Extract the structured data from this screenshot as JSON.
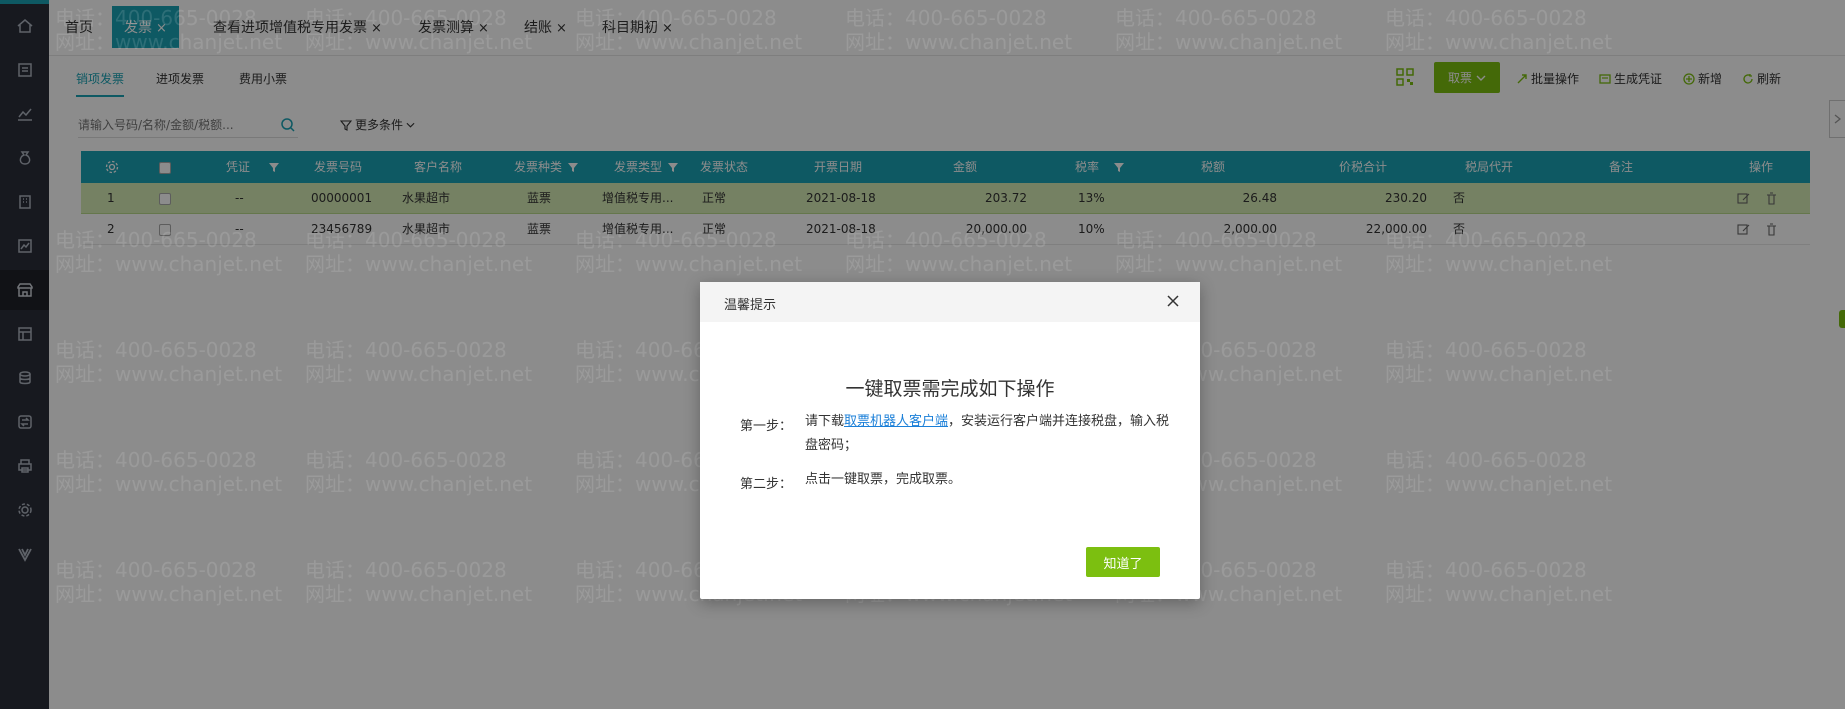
{
  "tabs": [
    {
      "label": "首页",
      "closable": false
    },
    {
      "label": "发票",
      "closable": true,
      "active": true
    },
    {
      "label": "查看进项增值税专用发票",
      "closable": true
    },
    {
      "label": "发票测算",
      "closable": true
    },
    {
      "label": "结账",
      "closable": true
    },
    {
      "label": "科目期初",
      "closable": true
    }
  ],
  "close_glyph": "×",
  "subtabs": [
    "销项发票",
    "进项发票",
    "费用小票"
  ],
  "toolbar": {
    "fetch_label": "取票",
    "batch_label": "批量操作",
    "voucher_label": "生成凭证",
    "add_label": "新增",
    "refresh_label": "刷新"
  },
  "search": {
    "placeholder": "请输入号码/名称/金额/税额..."
  },
  "more_conditions": "更多条件",
  "table": {
    "headers": {
      "voucher": "凭证",
      "number": "发票号码",
      "customer": "客户名称",
      "kind": "发票种类",
      "type": "发票类型",
      "status": "发票状态",
      "date": "开票日期",
      "amount": "金额",
      "rate": "税率",
      "tax": "税额",
      "total": "价税合计",
      "agent": "税局代开",
      "remark": "备注",
      "ops": "操作"
    },
    "rows": [
      {
        "idx": "1",
        "voucher": "--",
        "number": "00000001",
        "customer": "水果超市",
        "kind": "蓝票",
        "type": "增值税专用...",
        "status": "正常",
        "date": "2021-08-18",
        "amount": "203.72",
        "rate": "13%",
        "tax": "26.48",
        "total": "230.20",
        "agent": "否"
      },
      {
        "idx": "2",
        "voucher": "--",
        "number": "23456789",
        "customer": "水果超市",
        "kind": "蓝票",
        "type": "增值税专用...",
        "status": "正常",
        "date": "2021-08-18",
        "amount": "20,000.00",
        "rate": "10%",
        "tax": "2,000.00",
        "total": "22,000.00",
        "agent": "否"
      }
    ]
  },
  "watermark": {
    "phone": "电话：400-665-0028",
    "site": "网址：www.chanjet.net"
  },
  "dialog": {
    "title": "温馨提示",
    "heading": "一键取票需完成如下操作",
    "step1_label": "第一步：",
    "step1_pre": "请下载",
    "step1_link": "取票机器人客户端",
    "step1_post": "，安装运行客户端并连接税盘，输入税盘密码；",
    "step2_label": "第二步：",
    "step2_text": "点击一键取票，完成取票。",
    "ok_label": "知道了"
  }
}
